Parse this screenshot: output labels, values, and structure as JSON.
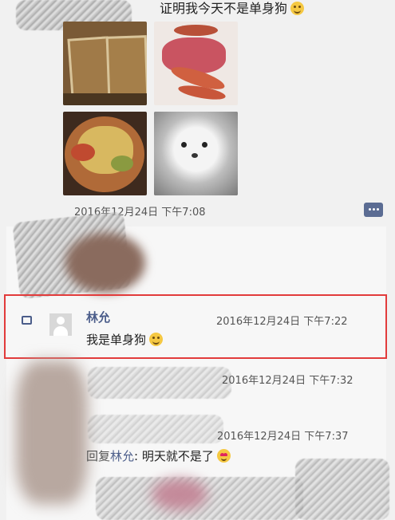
{
  "top_post": {
    "text": "证明我今天不是单身狗",
    "emoji": "smile-emoji",
    "photos": [
      {
        "name": "photo-food-tray"
      },
      {
        "name": "photo-shrimp-platter"
      },
      {
        "name": "photo-dish-bowl"
      },
      {
        "name": "photo-white-puppy"
      }
    ],
    "timestamp": "2016年12月24日 下午7:08",
    "icon": "comment-bubble-icon"
  },
  "comments": [
    {
      "author": "林允",
      "text": "我是单身狗",
      "emoji": "smile-emoji",
      "timestamp": "2016年12月24日 下午7:22",
      "highlighted": true
    },
    {
      "timestamp": "2016年12月24日 下午7:32"
    },
    {
      "timestamp": "2016年12月24日 下午7:37",
      "reply_prefix": "回复",
      "reply_to": "林允",
      "reply_text": ": 明天就不是了",
      "emoji": "heart-eyes-emoji"
    }
  ],
  "colors": {
    "highlight_border": "#e23b3b",
    "author_name": "#4b5d8a",
    "background": "#f1f1f1"
  }
}
